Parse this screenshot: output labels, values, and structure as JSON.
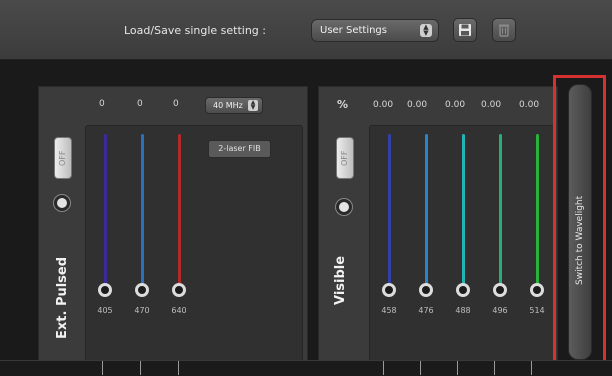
{
  "toolbar": {
    "label": "Load/Save single setting :",
    "select_value": "User Settings",
    "save_icon": "save-icon",
    "delete_icon": "delete-icon"
  },
  "left_panel": {
    "title": "Ext. Pulsed",
    "toggle_label": "OFF",
    "values": [
      "0",
      "0",
      "0"
    ],
    "frequency": "40 MHz",
    "mode_button": "2-laser FIB",
    "channels": [
      {
        "wavelength": "405",
        "color": "#3b2a9a"
      },
      {
        "wavelength": "470",
        "color": "#2b6fbf"
      },
      {
        "wavelength": "640",
        "color": "#b02a2a"
      }
    ]
  },
  "right_panel": {
    "title": "Visible",
    "unit": "%",
    "toggle_label": "OFF",
    "values": [
      "0.00",
      "0.00",
      "0.00",
      "0.00",
      "0.00"
    ],
    "channels": [
      {
        "wavelength": "458",
        "color": "#3340a8"
      },
      {
        "wavelength": "476",
        "color": "#2a84c8"
      },
      {
        "wavelength": "488",
        "color": "#22b3b3"
      },
      {
        "wavelength": "496",
        "color": "#24b077"
      },
      {
        "wavelength": "514",
        "color": "#29b23a"
      }
    ]
  },
  "switch_button": {
    "label": "Switch to Wavelight"
  },
  "colors": {
    "highlight": "#d63131",
    "panel": "#3b3b3b"
  }
}
